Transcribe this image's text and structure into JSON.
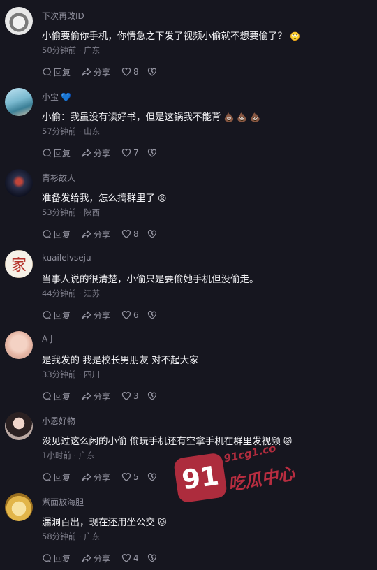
{
  "actions": {
    "reply": "回复",
    "share": "分享"
  },
  "comments": [
    {
      "name": "下次再改ID",
      "text": "小偷要偷你手机，你情急之下发了视频小偷就不想要偷了？",
      "emoji": "🙄",
      "time": "50分钟前",
      "sep": " · ",
      "location": "广东",
      "likes": "8",
      "avatar": "cat-avatar"
    },
    {
      "name": "小宝",
      "badge": "💙",
      "text": "小偷：我虽没有读好书，但是这锅我不能背",
      "emoji": "💩 💩 💩",
      "time": "57分钟前",
      "sep": " · ",
      "location": "山东",
      "likes": "7",
      "avatar": "sea-avatar"
    },
    {
      "name": "青衫故人",
      "text": "准备发给我，怎么搞群里了",
      "emoji": "😡",
      "time": "53分钟前",
      "sep": " · ",
      "location": "陕西",
      "likes": "8",
      "avatar": "dark-art-avatar"
    },
    {
      "name": "kuailelvseju",
      "text": "当事人说的很清楚，小偷只是要偷她手机但没偷走。",
      "emoji": "",
      "time": "44分钟前",
      "sep": " · ",
      "location": "江苏",
      "likes": "6",
      "avatar": "seal-avatar",
      "avatar_char": "家"
    },
    {
      "name": "A J",
      "text": "是我发的 我是校长男朋友 对不起大家",
      "emoji": "",
      "time": "33分钟前",
      "sep": " · ",
      "location": "四川",
      "likes": "3",
      "avatar": "baby-avatar"
    },
    {
      "name": "小恩好物",
      "text": "没见过这么闲的小偷 偷玩手机还有空拿手机在群里发视频",
      "emoji": "🐱",
      "time": "1小时前",
      "sep": " · ",
      "location": "广东",
      "likes": "5",
      "avatar": "woman-avatar"
    },
    {
      "name": "煮面放海胆",
      "text": "漏洞百出，现在还用坐公交",
      "emoji": "🐱",
      "time": "58分钟前",
      "sep": " · ",
      "location": "广东",
      "likes": "4",
      "avatar": "tiger-avatar"
    }
  ],
  "watermark": {
    "num": "91",
    "url": "91cg1.co",
    "cn": "吃瓜中心"
  }
}
